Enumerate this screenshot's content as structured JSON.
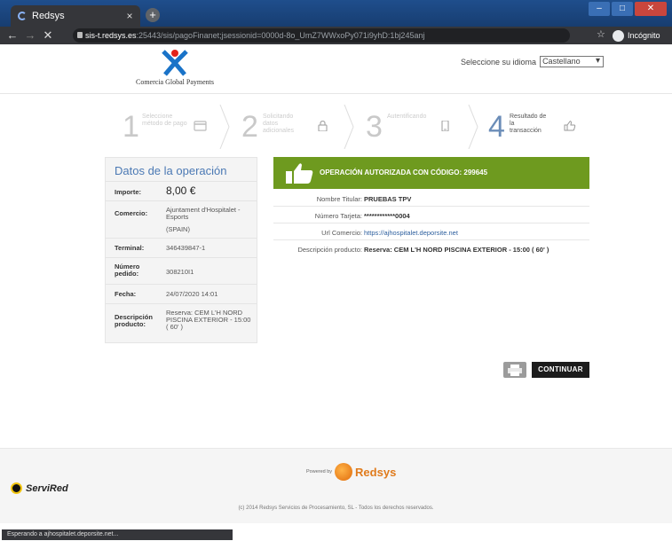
{
  "browser": {
    "tab_title": "Redsys",
    "tab_close": "×",
    "new_tab": "+",
    "url_host": "sis-t.redsys.es",
    "url_rest": ":25443/sis/pagoFinanet;jsessionid=0000d-8o_UmZ7WWxoPy071i9yhD:1bj245anj",
    "incognito_label": "Incógnito",
    "status_text": "Esperando a ajhospitalet.deporsite.net..."
  },
  "header": {
    "logo_text": "Comercia Global Payments",
    "language_label": "Seleccione su idioma",
    "language_value": "Castellano"
  },
  "steps": [
    {
      "num": "1",
      "label": "Seleccione\nmétodo de pago",
      "icon": "card-icon"
    },
    {
      "num": "2",
      "label": "Solicitando\ndatos\nadicionales",
      "icon": "lock-icon"
    },
    {
      "num": "3",
      "label": "Autentificando",
      "icon": "phone-icon"
    },
    {
      "num": "4",
      "label": "Resultado de\nla\ntransacción",
      "icon": "thumbs-up-icon"
    }
  ],
  "operation": {
    "title": "Datos de la operación",
    "importe_label": "Importe:",
    "importe_value": "8,00 €",
    "comercio_label": "Comercio:",
    "comercio_value": "Ajuntament d'Hospitalet - Esports",
    "comercio_country": "(SPAIN)",
    "terminal_label": "Terminal:",
    "terminal_value": "346439847-1",
    "pedido_label": "Número pedido:",
    "pedido_value": "308210I1",
    "fecha_label": "Fecha:",
    "fecha_value": "24/07/2020  14:01",
    "descripcion_label": "Descripción producto:",
    "descripcion_value": "Reserva: CEM L'H NORD PISCINA EXTERIOR - 15:00 ( 60' )"
  },
  "result": {
    "banner": "OPERACIÓN AUTORIZADA CON CÓDIGO: 299645",
    "rows": [
      {
        "label": "Nombre Titular:",
        "value": "PRUEBAS TPV"
      },
      {
        "label": "Número Tarjeta:",
        "value": "************0004"
      },
      {
        "label": "Url Comercio:",
        "value": "https://ajhospitalet.deporsite.net"
      },
      {
        "label": "Descripción producto:",
        "value": "Reserva: CEM L'H NORD PISCINA EXTERIOR - 15:00 ( 60' )"
      }
    ],
    "continue_label": "CONTINUAR"
  },
  "footer": {
    "powered_by": "Powered by",
    "redsys": "Redsys",
    "servired": "ServiRed",
    "copyright": "(c) 2014 Redsys Servicios de Procesamiento, SL - Todos los derechos reservados."
  },
  "colors": {
    "accent_blue": "#4b79b4",
    "success_green": "#6e9a1f",
    "redsys_orange": "#e07b1c"
  }
}
